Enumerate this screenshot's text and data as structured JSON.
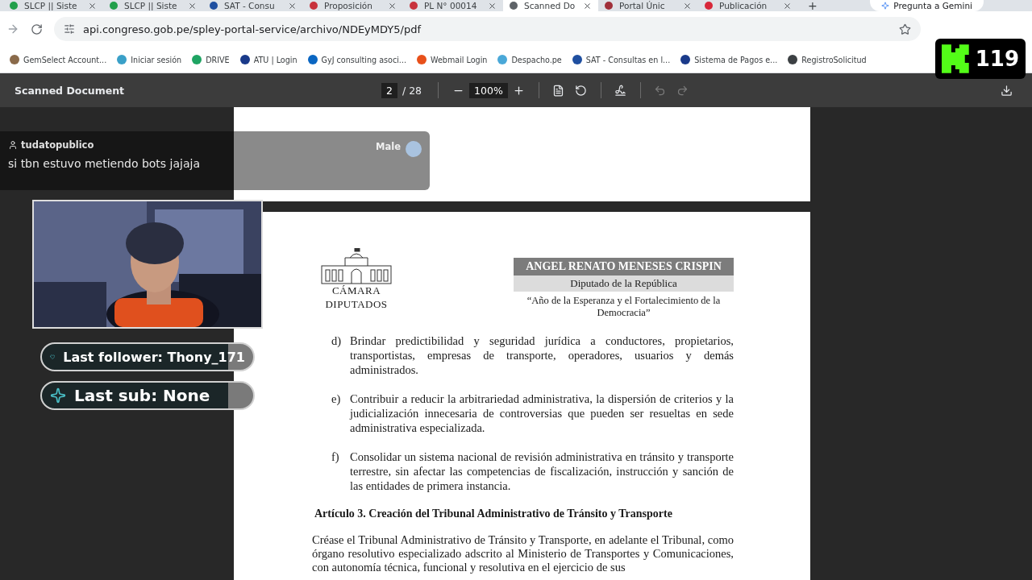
{
  "browser": {
    "tabs": [
      {
        "title": "SLCP || Siste",
        "color": "#22a04b",
        "selected": false
      },
      {
        "title": "SLCP || Siste",
        "color": "#22a04b",
        "selected": false
      },
      {
        "title": "SAT - Consu",
        "color": "#1f4fa0",
        "selected": false
      },
      {
        "title": "Proposición",
        "color": "#c8323c",
        "selected": false
      },
      {
        "title": "PL N° 00014",
        "color": "#c8323c",
        "selected": false
      },
      {
        "title": "Scanned Do",
        "color": "#5f6368",
        "selected": true
      },
      {
        "title": "Portal Únic",
        "color": "#a0303a",
        "selected": false
      },
      {
        "title": "Publicación",
        "color": "#d8283a",
        "selected": false
      }
    ],
    "new_tab": "+",
    "gemini_button": "Pregunta a Gemini",
    "url": "api.congreso.gob.pe/spley-portal-service/archivo/NDEyMDY5/pdf",
    "bookmarks": [
      {
        "label": "GemSelect Account...",
        "color": "#8a6a4a"
      },
      {
        "label": "Iniciar sesión",
        "color": "#3aa0c8"
      },
      {
        "label": "DRIVE",
        "color": "#1fa463"
      },
      {
        "label": "ATU | Login",
        "color": "#1a3a8a"
      },
      {
        "label": "GyJ consulting asoci...",
        "color": "#0a66c2"
      },
      {
        "label": "Webmail Login",
        "color": "#e8501a"
      },
      {
        "label": "Despacho.pe",
        "color": "#4aa8d8"
      },
      {
        "label": "SAT - Consultas en l...",
        "color": "#1f4fa0"
      },
      {
        "label": "Sistema de Pagos e...",
        "color": "#1a3a8a"
      },
      {
        "label": "RegistroSolicitud",
        "color": "#3c4043"
      }
    ]
  },
  "pdf_viewer": {
    "title": "Scanned Document",
    "page": "2",
    "page_total": "/ 28",
    "zoom": "100%",
    "document": {
      "header": {
        "logo_top": "CÁMARA",
        "logo_bottom": "DIPUTADOS",
        "name": "ANGEL RENATO MENESES CRISPIN",
        "role": "Diputado de la República",
        "motto": "“Año de la Esperanza y el Fortalecimiento de la Democracia”"
      },
      "items": [
        {
          "letter": "d)",
          "text": "Brindar predictibilidad y seguridad jurídica a conductores, propietarios, transportistas, empresas de transporte, operadores, usuarios y demás administrados."
        },
        {
          "letter": "e)",
          "text": "Contribuir a reducir la arbitrariedad administrativa, la dispersión de criterios y la judicialización innecesaria de controversias que pueden ser resueltas en sede administrativa especializada."
        },
        {
          "letter": "f)",
          "text": "Consolidar un sistema nacional de revisión administrativa en tránsito y transporte terrestre, sin afectar las competencias de fiscalización, instrucción y sanción de las entidades de primera instancia."
        }
      ],
      "heading": "Artículo 3. Creación del Tribunal Administrativo de Tránsito y Transporte",
      "paragraph": "Créase el Tribunal Administrativo de Tránsito y Transporte, en adelante el Tribunal, como órgano resolutivo especializado adscrito al Ministerio de Transportes y Comunicaciones, con autonomía técnica, funcional y resolutiva en el ejercicio de sus"
    }
  },
  "stream_overlay": {
    "chat": {
      "user": "tudatopublico",
      "message": "si tbn estuvo metiendo bots jajaja",
      "other_user": "Male"
    },
    "last_follower": "Last follower: Thony_171",
    "last_sub": "Last sub: None",
    "viewer_count": "119"
  }
}
